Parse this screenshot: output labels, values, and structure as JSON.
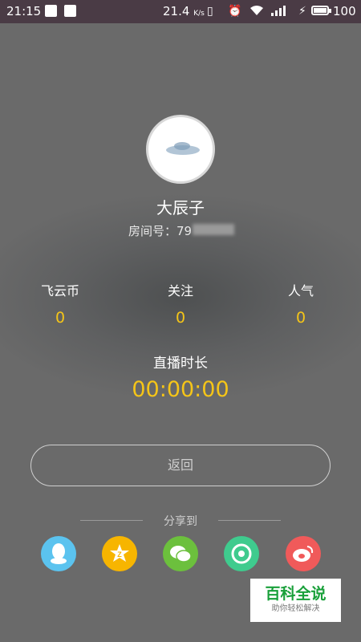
{
  "status_bar": {
    "time": "21:15",
    "net_speed": "21.4",
    "net_unit": "K/s",
    "battery": "100"
  },
  "profile": {
    "name": "大辰子",
    "room_label": "房间号：79"
  },
  "stats": [
    {
      "label": "飞云币",
      "value": "0"
    },
    {
      "label": "关注",
      "value": "0"
    },
    {
      "label": "人气",
      "value": "0"
    }
  ],
  "live": {
    "duration_label": "直播时长",
    "duration_value": "00:00:00"
  },
  "back_button": "返回",
  "share": {
    "label": "分享到",
    "icons": [
      {
        "name": "qq-icon",
        "color": "#5bc3ef"
      },
      {
        "name": "qzone-icon",
        "color": "#f7b500"
      },
      {
        "name": "wechat-icon",
        "color": "#6cc03d"
      },
      {
        "name": "moments-icon",
        "color": "#3fcb8e"
      },
      {
        "name": "weibo-icon",
        "color": "#f05a5a"
      }
    ]
  },
  "watermark": {
    "title": "百科全说",
    "subtitle": "助你轻松解决"
  },
  "colors": {
    "accent": "#f5c518",
    "status_bar": "#4a3b45"
  }
}
